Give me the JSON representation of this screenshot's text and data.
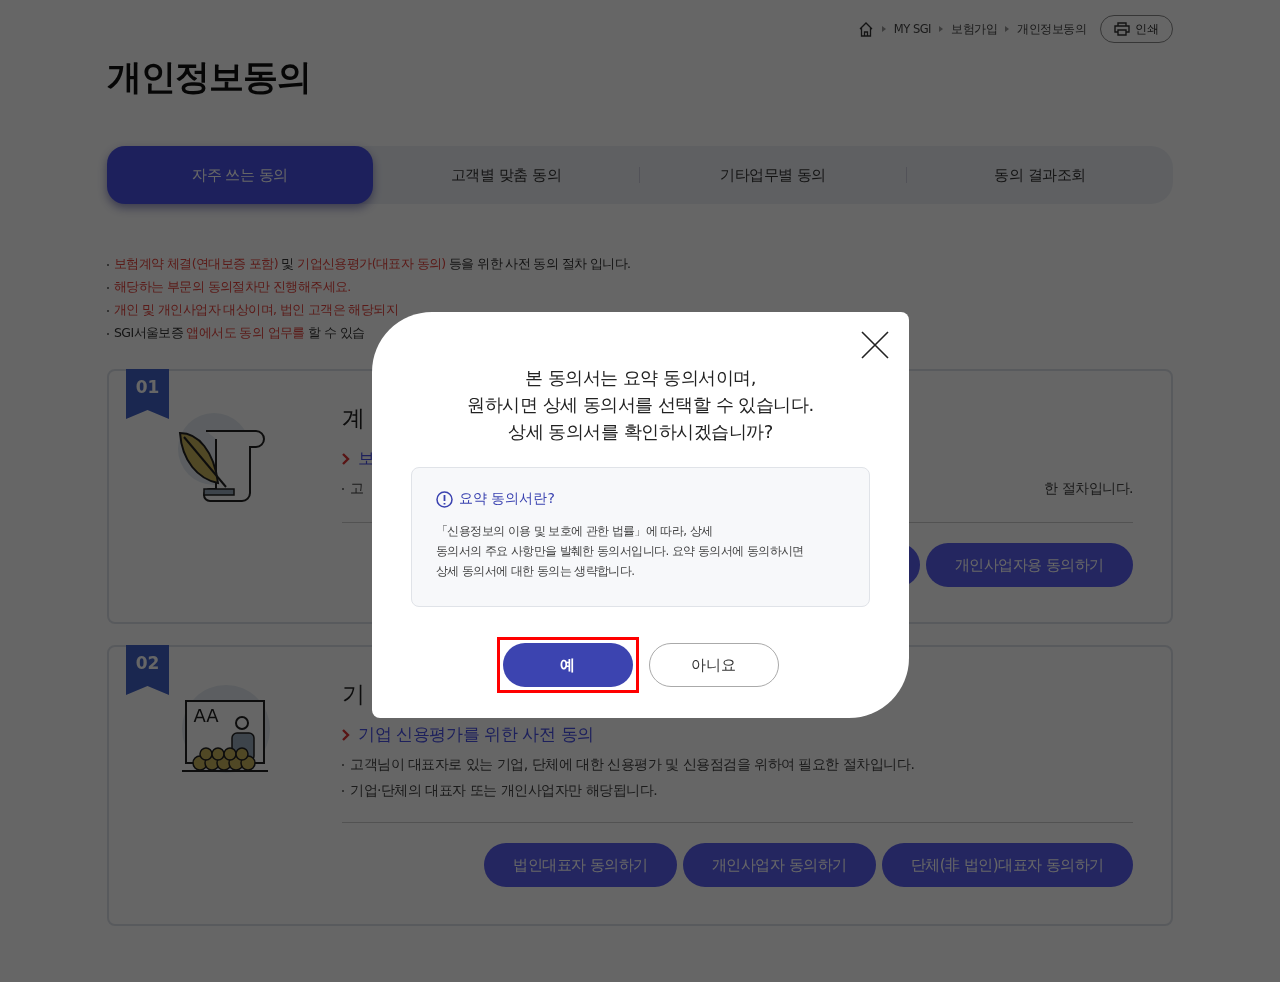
{
  "breadcrumb": {
    "items": [
      "MY SGI",
      "보험가입",
      "개인정보동의"
    ],
    "print_button": "인쇄"
  },
  "page_title": "개인정보동의",
  "tabs": [
    {
      "label": "자주 쓰는 동의",
      "selected": true
    },
    {
      "label": "고객별 맞춤 동의",
      "selected": false
    },
    {
      "label": "기타업무별 동의",
      "selected": false
    },
    {
      "label": "동의 결과조회",
      "selected": false
    }
  ],
  "notes": [
    {
      "parts": [
        {
          "text": "보험계약 체결(연대보증 포함)",
          "kind": "highlight"
        },
        {
          "text": " 및 ",
          "kind": "plain"
        },
        {
          "text": "기업신용평가(대표자 동의)",
          "kind": "highlight"
        },
        {
          "text": " 등을 위한 사전 동의 절차 입니다.",
          "kind": "plain"
        }
      ]
    },
    {
      "parts": [
        {
          "text": "해당하는 부문의 동의절차만 진행해주세요.",
          "kind": "highlight"
        }
      ]
    },
    {
      "parts": [
        {
          "text": "개인 및 개인사업자 대상이며, 법인 고객은 해당되지",
          "kind": "highlight"
        }
      ]
    },
    {
      "parts": [
        {
          "text": "SGI서울보증 ",
          "kind": "plain"
        },
        {
          "text": "앱에서도 동의 업무를",
          "kind": "highlight"
        },
        {
          "text": " 할 수 있습",
          "kind": "plain"
        }
      ]
    }
  ],
  "cards": [
    {
      "number": "01",
      "kind": "quill",
      "title": "계",
      "link": "보",
      "descriptions": [
        {
          "segments": [
            "고",
            "한 절차입니다."
          ]
        }
      ],
      "buttons": [
        {
          "kind": "covered"
        },
        {
          "kind": "label",
          "label": "개인사업자용 동의하기"
        }
      ]
    },
    {
      "number": "02",
      "kind": "classroom",
      "board_text": "AA",
      "title": "기",
      "link": "기업 신용평가를 위한 사전 동의",
      "descriptions": [
        {
          "segments": [
            "고객님이 대표자로 있는 기업, 단체에 대한 신용평가 및 신용점검을 위하여 필요한 절차입니다."
          ]
        },
        {
          "segments": [
            "기업·단체의 대표자 또는 개인사업자만 해당됩니다."
          ]
        }
      ],
      "buttons": [
        {
          "kind": "label",
          "label": "법인대표자 동의하기"
        },
        {
          "kind": "label",
          "label": "개인사업자 동의하기"
        },
        {
          "kind": "label",
          "label": "단체(非 법인)대표자 동의하기"
        }
      ]
    }
  ],
  "modal": {
    "message": [
      "본 동의서는 요약 동의서이며,",
      "원하시면 상세 동의서를 선택할 수 있습니다.",
      "상세 동의서를 확인하시겠습니까?"
    ],
    "info_title": "요약 동의서란?",
    "info_text": [
      "「신용정보의 이용 및 보호에 관한 법률」에 따라, 상세",
      "동의서의 주요 사항만을 발췌한 동의서입니다. 요약 동의서에 동의하시면",
      "상세 동의서에 대한 동의는 생략합니다."
    ],
    "buttons": [
      {
        "label": "예",
        "kind": "primary",
        "highlighted": true
      },
      {
        "label": "아니요",
        "kind": "secondary",
        "highlighted": false
      }
    ]
  }
}
